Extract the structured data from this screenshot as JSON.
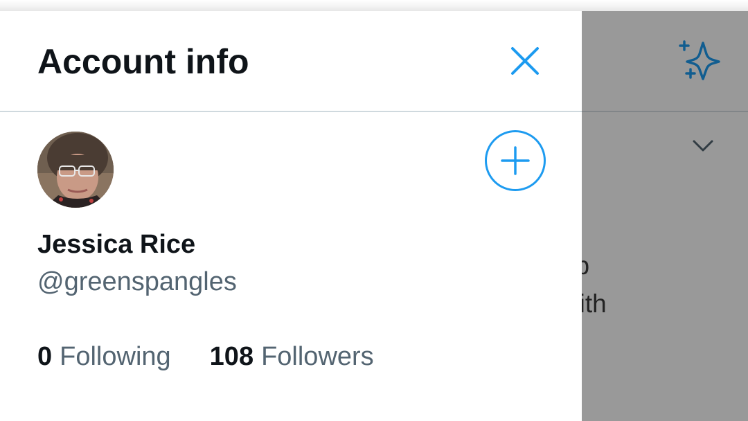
{
  "drawer": {
    "title": "Account info",
    "close_icon": "close-icon",
    "add_account_icon": "plus-circle-icon"
  },
  "profile": {
    "display_name": "Jessica Rice",
    "handle": "@greenspangles",
    "following_count": "0",
    "following_label": "Following",
    "followers_count": "108",
    "followers_label": "Followers"
  },
  "background": {
    "header_icon": "sparkle-icon",
    "dropdown_icon": "chevron-down-icon",
    "text_line_1": "to help",
    "text_line_2": "ting with"
  },
  "colors": {
    "accent": "#1d9bf0",
    "primary_text": "#0f1419",
    "secondary_text": "#536471",
    "scrim": "rgba(0,0,0,0.40)"
  }
}
